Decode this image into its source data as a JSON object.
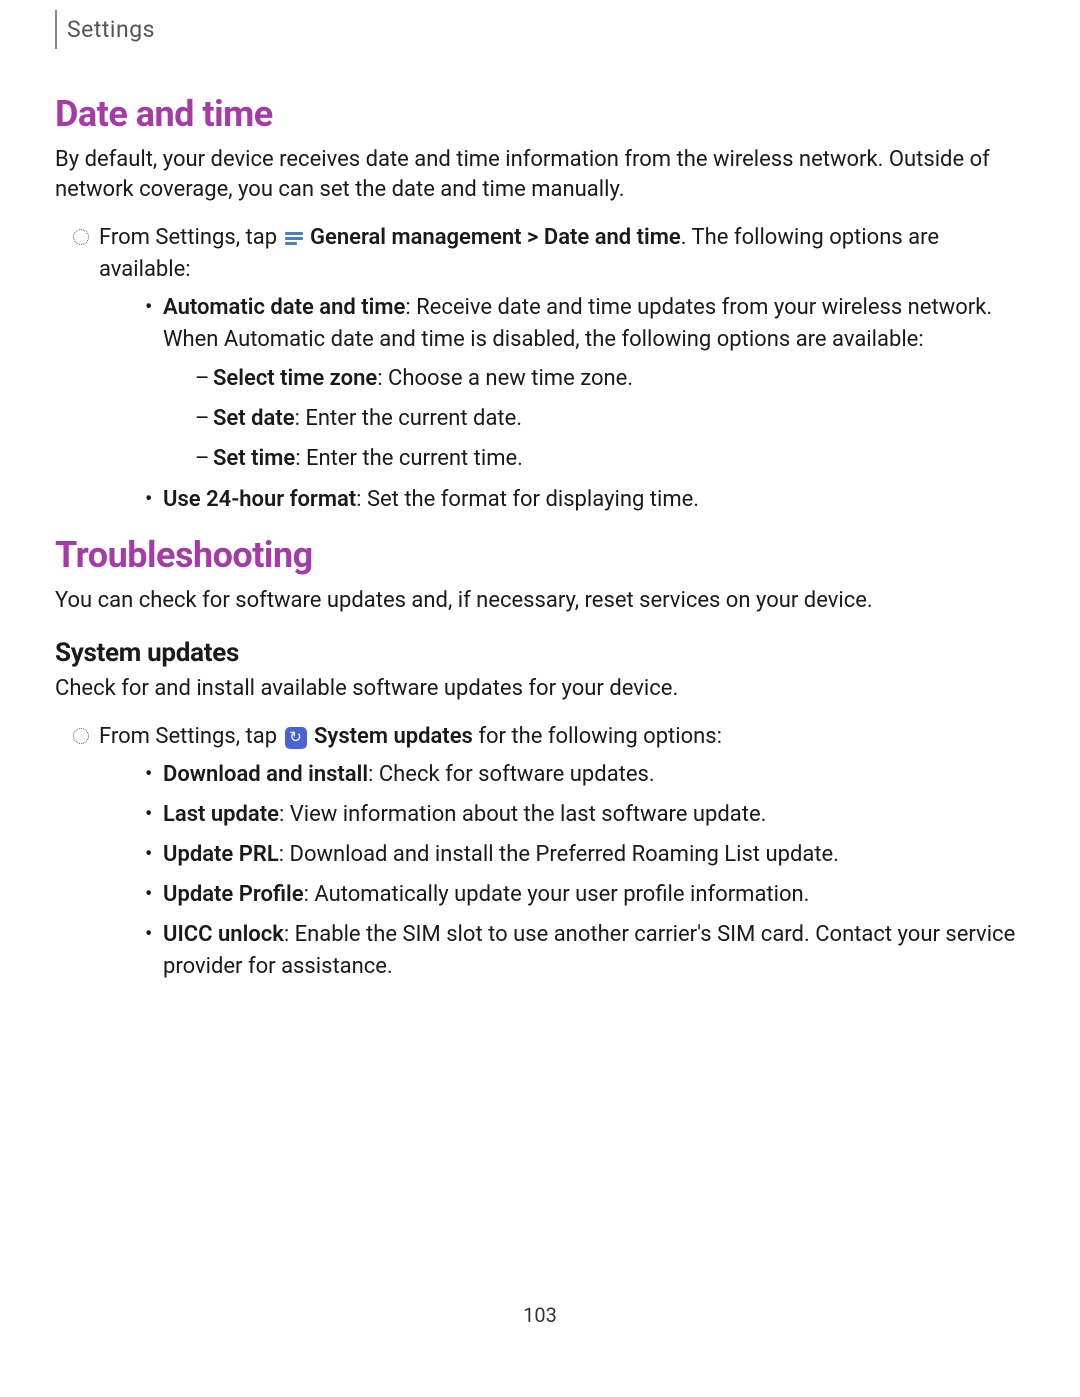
{
  "header": {
    "tab": "Settings"
  },
  "section1": {
    "title": "Date and time",
    "intro": "By default, your device receives date and time information from the wireless network. Outside of network coverage, you can set the date and time manually.",
    "step_prefix": "From Settings, tap ",
    "step_bold1": "General management",
    "step_sep": " > ",
    "step_bold2": "Date and time",
    "step_suffix": ". The following options are available:",
    "bullets": [
      {
        "label": "Automatic date and time",
        "text": ": Receive date and time updates from your wireless network. When Automatic date and time is disabled, the following options are available:"
      },
      {
        "label": "Use 24-hour format",
        "text": ": Set the format for displaying time."
      }
    ],
    "subdashes": [
      {
        "label": "Select time zone",
        "text": ": Choose a new time zone."
      },
      {
        "label": "Set date",
        "text": ": Enter the current date."
      },
      {
        "label": "Set time",
        "text": ": Enter the current time."
      }
    ]
  },
  "section2": {
    "title": "Troubleshooting",
    "intro": "You can check for software updates and, if necessary, reset services on your device.",
    "sub": {
      "title": "System updates",
      "intro": "Check for and install available software updates for your device.",
      "step_prefix": "From Settings, tap ",
      "step_bold": "System updates",
      "step_suffix": " for the following options:",
      "bullets": [
        {
          "label": "Download and install",
          "text": ": Check for software updates."
        },
        {
          "label": "Last update",
          "text": ": View information about the last software update."
        },
        {
          "label": "Update PRL",
          "text": ": Download and install the Preferred Roaming List update."
        },
        {
          "label": "Update Profile",
          "text": ": Automatically update your user profile information."
        },
        {
          "label": "UICC unlock",
          "text": ": Enable the SIM slot to use another carrier's SIM card. Contact your service provider for assistance."
        }
      ]
    }
  },
  "page_number": "103"
}
